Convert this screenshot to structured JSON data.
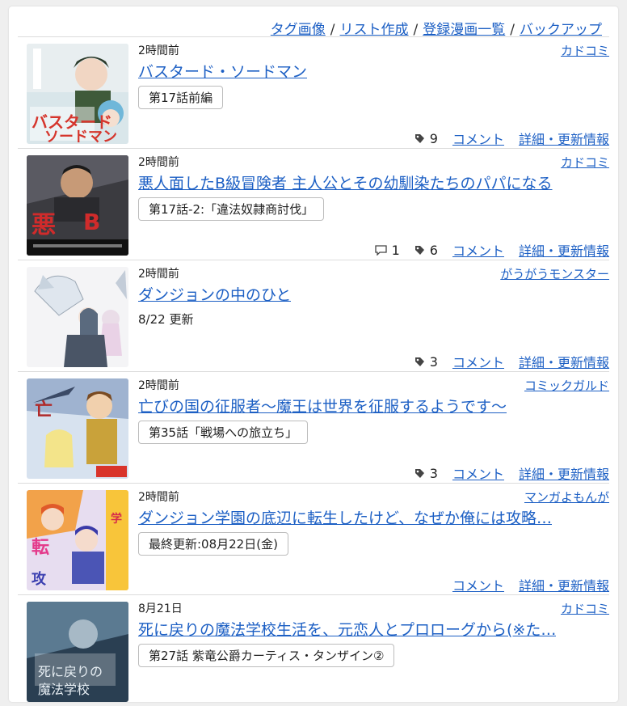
{
  "nav": {
    "tag_images": "タグ画像",
    "create_list": "リスト作成",
    "registered_list": "登録漫画一覧",
    "backup": "バックアップ",
    "sep": "/"
  },
  "items": [
    {
      "time": "2時間前",
      "publisher": "カドコミ",
      "title": "バスタード・ソードマン",
      "episode": "第17話前編",
      "tags": "9",
      "comment": "コメント",
      "details": "詳細・更新情報"
    },
    {
      "time": "2時間前",
      "publisher": "カドコミ",
      "title": "悪人面したB級冒険者 主人公とその幼馴染たちのパパになる",
      "episode": "第17話-2:「違法奴隷商討伐」",
      "comments_count": "1",
      "tags": "6",
      "comment": "コメント",
      "details": "詳細・更新情報"
    },
    {
      "time": "2時間前",
      "publisher": "がうがうモンスター",
      "title": "ダンジョンの中のひと",
      "update": "8/22 更新",
      "tags": "3",
      "comment": "コメント",
      "details": "詳細・更新情報"
    },
    {
      "time": "2時間前",
      "publisher": "コミックガルド",
      "title": "亡びの国の征服者～魔王は世界を征服するようです～",
      "episode": "第35話「戦場への旅立ち」",
      "tags": "3",
      "comment": "コメント",
      "details": "詳細・更新情報"
    },
    {
      "time": "2時間前",
      "publisher": "マンガよもんが",
      "title": "ダンジョン学園の底辺に転生したけど、なぜか俺には攻略…",
      "episode": "最終更新:08月22日(金)",
      "comment": "コメント",
      "details": "詳細・更新情報"
    },
    {
      "time": "8月21日",
      "publisher": "カドコミ",
      "title": "死に戻りの魔法学校生活を、元恋人とプロローグから(※た…",
      "episode": "第27話 紫竜公爵カーティス・タンザイン②"
    }
  ],
  "colors": {
    "link": "#1c5fc4",
    "background": "#efefef",
    "panel": "#ffffff"
  },
  "icons": [
    "tag-icon",
    "comment-icon"
  ]
}
